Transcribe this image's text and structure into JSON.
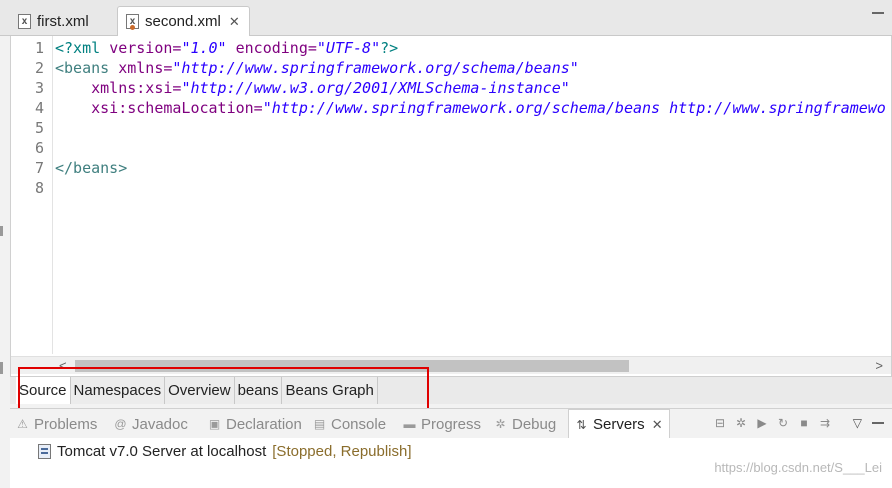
{
  "editor_tabs": [
    {
      "label": "first.xml",
      "active": false
    },
    {
      "label": "second.xml",
      "active": true,
      "close": "✕"
    }
  ],
  "editor": {
    "line_numbers": [
      "1",
      "2",
      "3",
      "4",
      "5",
      "6",
      "7",
      "8"
    ],
    "code": {
      "l1": {
        "open": "<?xml ",
        "a1": "version=",
        "v1": "\"1.0\"",
        "a2": " encoding=",
        "v2": "\"UTF-8\"",
        "close": "?>"
      },
      "l2": {
        "open": "<beans ",
        "a1": "xmlns=",
        "v1": "\"http://www.springframework.org/schema/beans\""
      },
      "l3": {
        "indent": "    ",
        "a1": "xmlns:xsi=",
        "v1": "\"http://www.w3.org/2001/XMLSchema-instance\""
      },
      "l4": {
        "indent": "    ",
        "a1": "xsi:schemaLocation=",
        "v1": "\"http://www.springframework.org/schema/beans http://www.springframewo"
      },
      "l7": {
        "close_tag": "</beans>"
      }
    }
  },
  "scrollbar": {
    "left_arrow": "<",
    "right_arrow": ">"
  },
  "mode_tabs": [
    {
      "label": "Source",
      "active": true
    },
    {
      "label": "Namespaces",
      "active": false
    },
    {
      "label": "Overview",
      "active": false
    },
    {
      "label": "beans",
      "active": false
    },
    {
      "label": "Beans Graph",
      "active": false
    }
  ],
  "view_tabs": [
    {
      "label": "Problems",
      "icon": "problems-icon"
    },
    {
      "label": "Javadoc",
      "icon": "javadoc-icon"
    },
    {
      "label": "Declaration",
      "icon": "declaration-icon"
    },
    {
      "label": "Console",
      "icon": "console-icon"
    },
    {
      "label": "Progress",
      "icon": "progress-icon"
    },
    {
      "label": "Debug",
      "icon": "debug-icon"
    },
    {
      "label": "Servers",
      "icon": "servers-icon",
      "active": true,
      "close": "✕"
    }
  ],
  "servers": [
    {
      "name": "Tomcat v7.0 Server at localhost",
      "status": "[Stopped, Republish]"
    }
  ],
  "watermark": "https://blog.csdn.net/S___Lei",
  "colors": {
    "highlight_box": "#e00000",
    "xml_tag": "#3f7f7f",
    "xml_attr": "#7f007f",
    "xml_value": "#2a00ff"
  }
}
